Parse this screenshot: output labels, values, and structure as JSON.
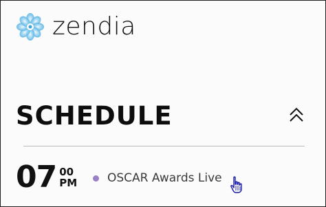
{
  "brand": {
    "name": "zendia",
    "logo_icon": "flower-icon",
    "colors": {
      "petal_light": "#bfe4f7",
      "petal_dark": "#3aa6dd"
    }
  },
  "section": {
    "title": "SCHEDULE",
    "collapse_icon": "double-chevron-up-icon"
  },
  "schedule": {
    "items": [
      {
        "hour": "07",
        "minutes": "00",
        "ampm": "PM",
        "title": "OSCAR Awards Live",
        "dot_color": "#9b7fc4"
      }
    ]
  }
}
